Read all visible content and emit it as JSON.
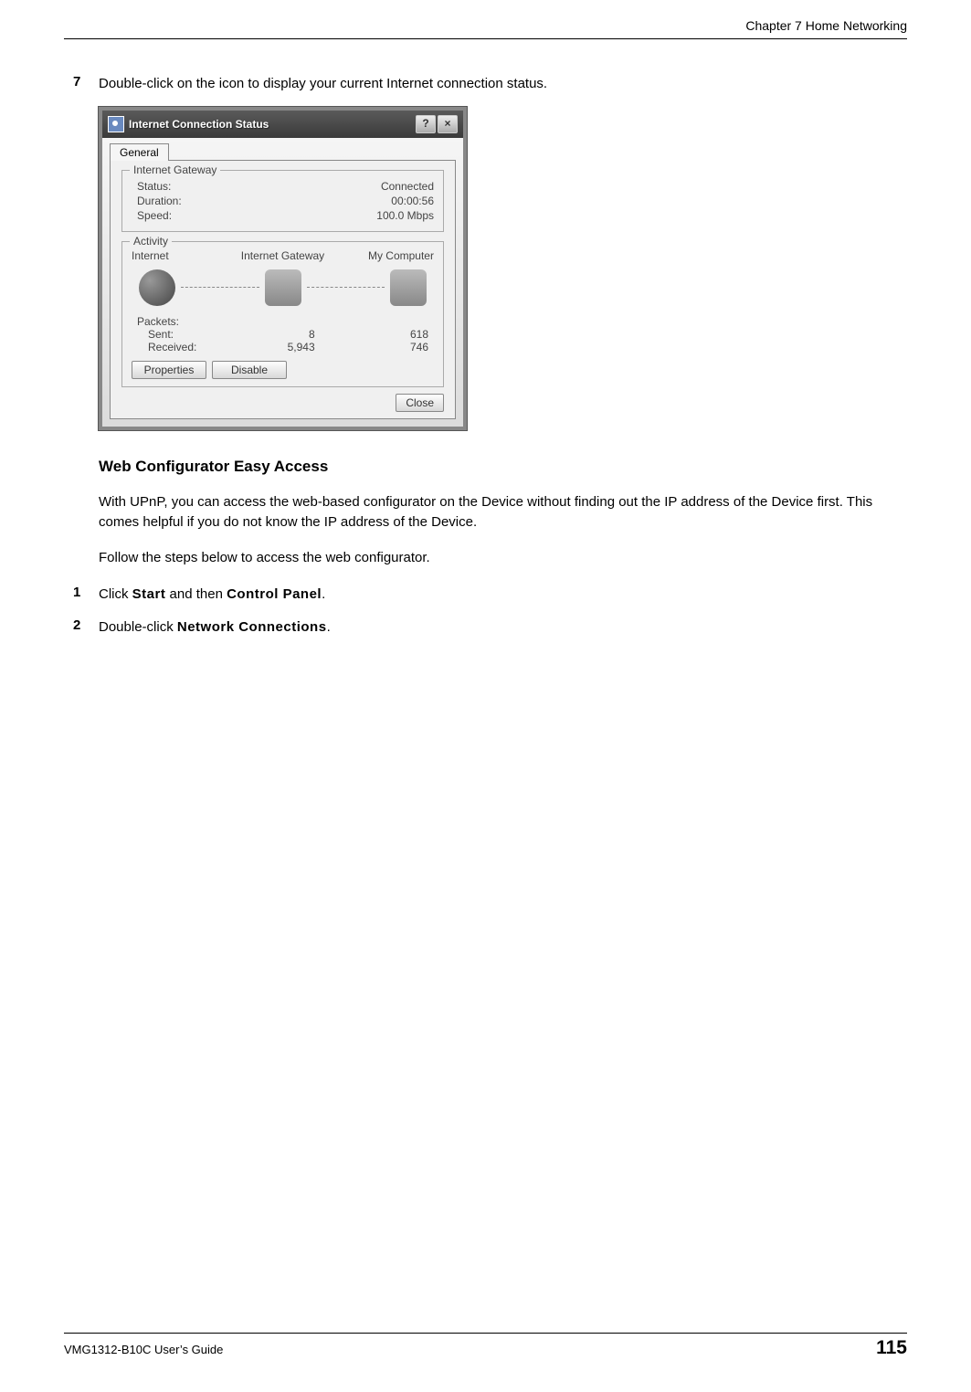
{
  "header": {
    "chapter": "Chapter 7 Home Networking"
  },
  "step7": {
    "num": "7",
    "text": "Double-click on the icon to display your current Internet connection status."
  },
  "dialog": {
    "title": "Internet Connection Status",
    "help": "?",
    "close_x": "×",
    "tab": "General",
    "group_gateway": {
      "label": "Internet Gateway",
      "status_lbl": "Status:",
      "status_val": "Connected",
      "duration_lbl": "Duration:",
      "duration_val": "00:00:56",
      "speed_lbl": "Speed:",
      "speed_val": "100.0 Mbps"
    },
    "group_activity": {
      "label": "Activity",
      "col1": "Internet",
      "col2": "Internet Gateway",
      "col3": "My Computer",
      "packets_lbl": "Packets:",
      "sent_lbl": "Sent:",
      "recv_lbl": "Received:",
      "sent_gw": "8",
      "recv_gw": "5,943",
      "sent_pc": "618",
      "recv_pc": "746"
    },
    "btn_properties": "Properties",
    "btn_disable": "Disable",
    "btn_close": "Close"
  },
  "subheading": "Web Configurator Easy Access",
  "para1": "With UPnP, you can access the web-based configurator on the Device without finding out the IP address of the Device first. This comes helpful if you do not know the IP address of the Device.",
  "para2": "Follow the steps below to access the web configurator.",
  "step1": {
    "num": "1",
    "pre": "Click ",
    "kw1": "Start",
    "mid": " and then ",
    "kw2": "Control Panel",
    "post": "."
  },
  "step2": {
    "num": "2",
    "pre": "Double-click ",
    "kw1": "Network Connections",
    "post": "."
  },
  "footer": {
    "guide": "VMG1312-B10C User’s Guide",
    "page": "115"
  }
}
